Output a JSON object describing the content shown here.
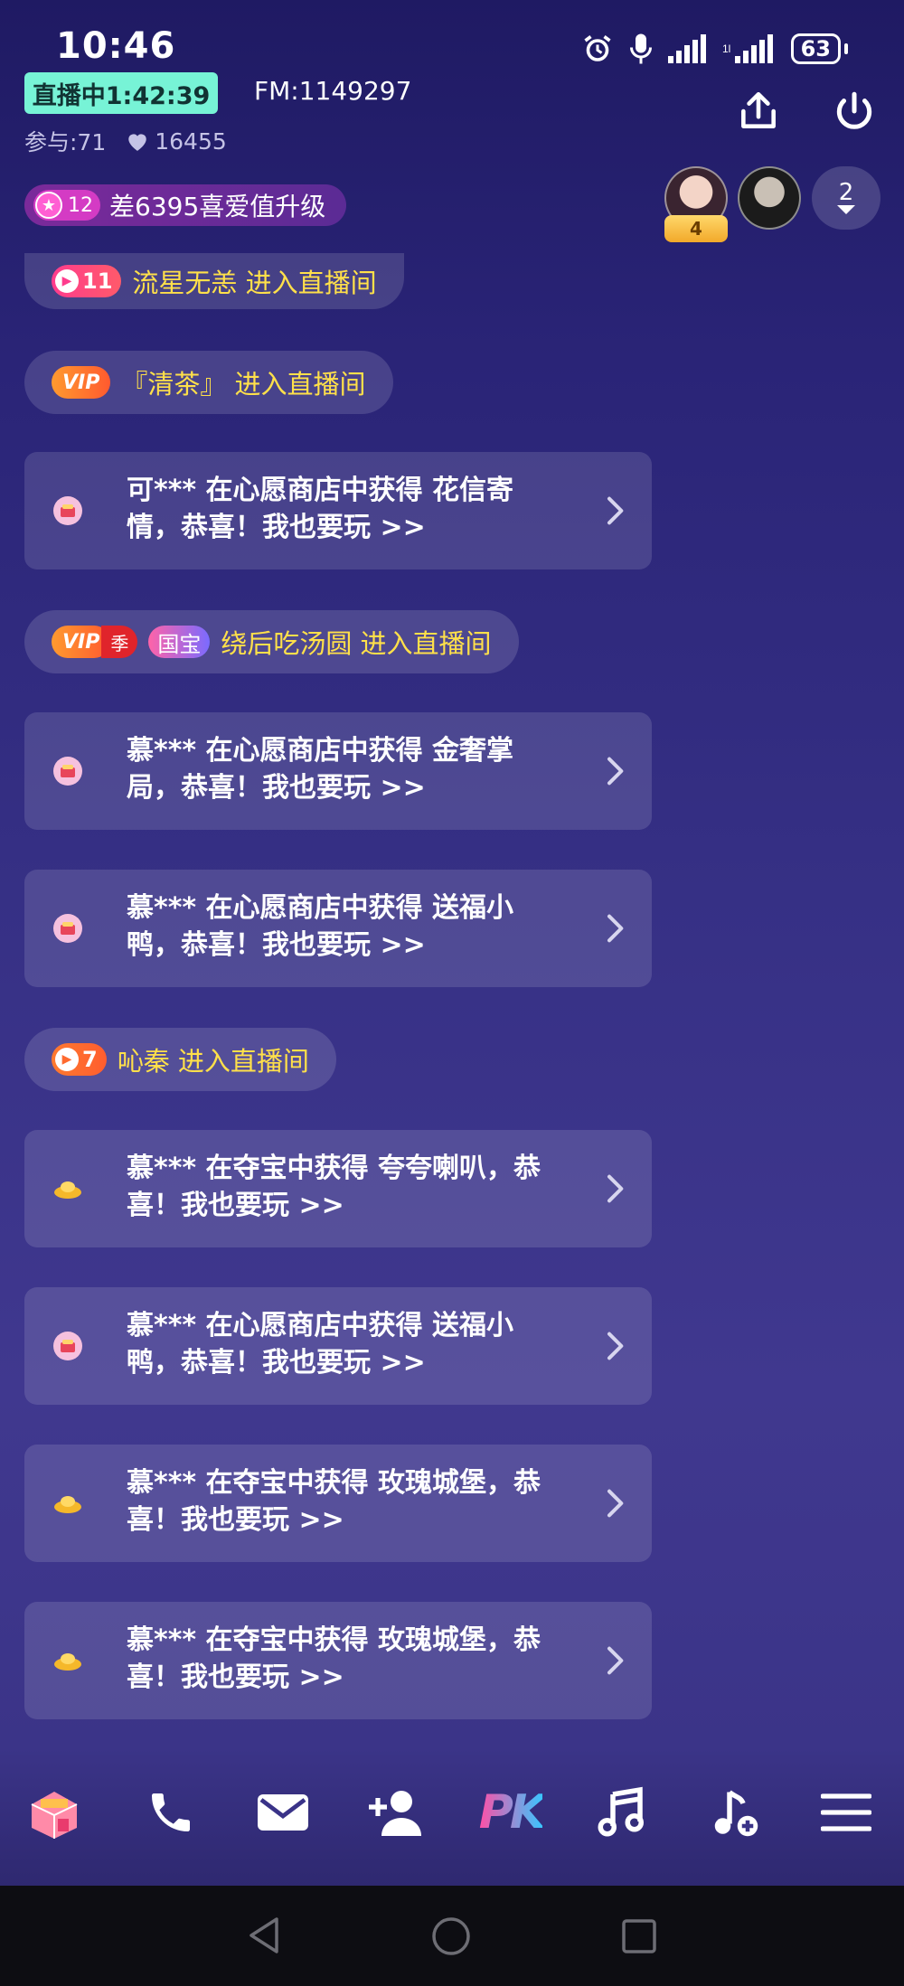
{
  "status_bar": {
    "time": "10:46",
    "battery": "63",
    "icons": [
      "alarm-icon",
      "mic-icon",
      "signal-icon",
      "signal-4g-icon",
      "battery-icon"
    ]
  },
  "header": {
    "live_label": "直播中1:42:39",
    "fm": "FM:1149297",
    "participants": "参与:71",
    "likes": "16455",
    "love_level": "12",
    "love_text": "差6395喜爱值升级",
    "avatar_badge": "4",
    "viewer_count": "2"
  },
  "messages": {
    "m1": {
      "rank": "11",
      "text": "流星无恙 进入直播间"
    },
    "m2": {
      "vip": "VIP",
      "text": "『清茶』 进入直播间"
    },
    "c1": {
      "text": "可*** 在心愿商店中获得 花信寄情，恭喜！我也要玩 >>"
    },
    "m3": {
      "vip": "VIP",
      "season": "季",
      "guobao": "国宝",
      "text": "绕后吃汤圆 进入直播间"
    },
    "c2": {
      "text": "慕*** 在心愿商店中获得 金奢掌局，恭喜！我也要玩 >>"
    },
    "c3": {
      "text": "慕*** 在心愿商店中获得 送福小鸭，恭喜！我也要玩 >>"
    },
    "m4": {
      "rank": "7",
      "text": "吣秦 进入直播间"
    },
    "c4": {
      "text": "慕*** 在夺宝中获得 夸夸喇叭，恭喜！我也要玩 >>"
    },
    "c5": {
      "text": "慕*** 在心愿商店中获得 送福小鸭，恭喜！我也要玩 >>"
    },
    "c6": {
      "text": "慕*** 在夺宝中获得 玫瑰城堡，恭喜！我也要玩 >>"
    },
    "c7": {
      "text": "慕*** 在夺宝中获得 玫瑰城堡，恭喜！我也要玩 >>"
    }
  },
  "toolbar": {
    "pk_label": "PK",
    "items": [
      "shop-icon",
      "phone-icon",
      "mail-icon",
      "add-user-icon",
      "pk-icon",
      "music-icon",
      "music-add-icon",
      "menu-icon"
    ]
  },
  "colors": {
    "live_badge": "#77f3d6",
    "highlight_text": "#ffe04a",
    "background_top": "#1f1a63",
    "background_mid": "#40388f"
  }
}
